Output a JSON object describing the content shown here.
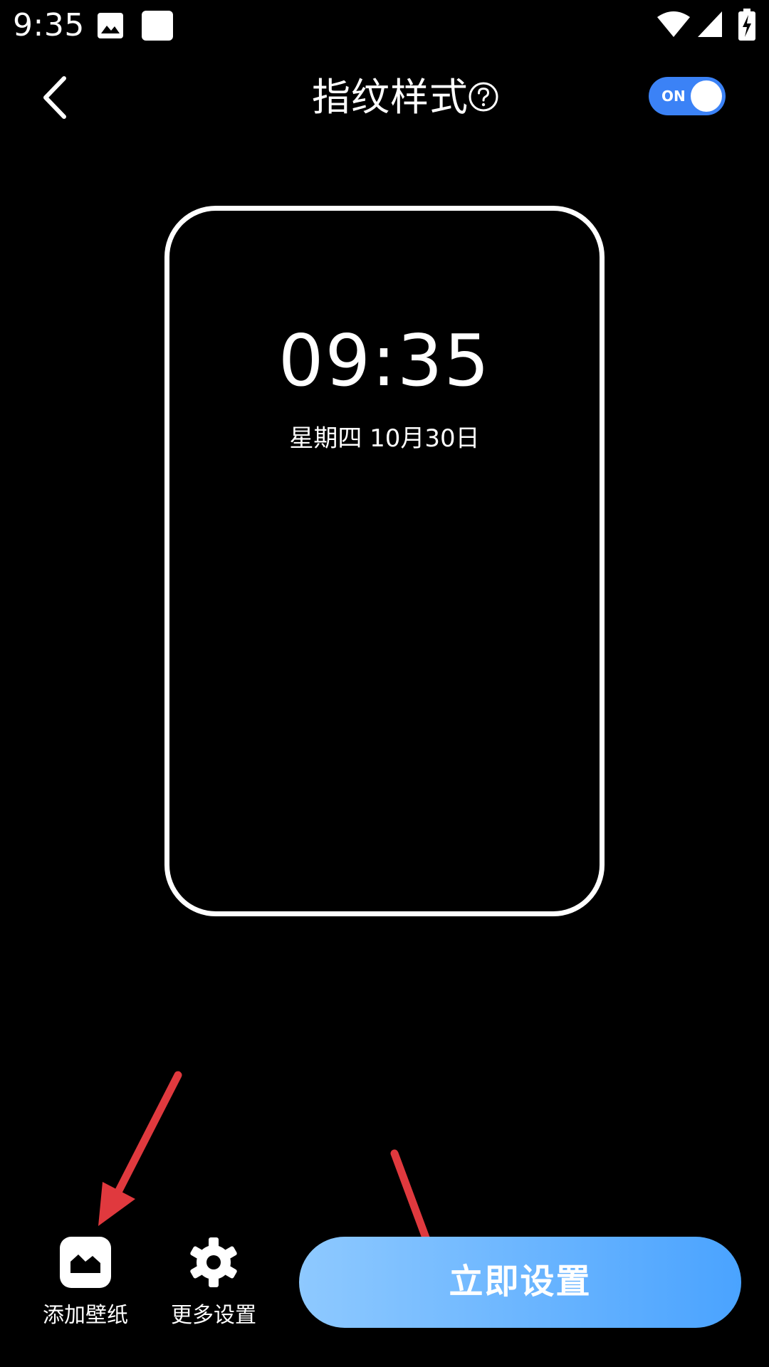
{
  "status_bar": {
    "time": "9:35",
    "icons": [
      "gallery-icon",
      "square-app-icon",
      "wifi-icon",
      "signal-icon",
      "battery-charging-icon"
    ]
  },
  "app_bar": {
    "title": "指纹样式",
    "toggle_label": "ON",
    "toggle_on": true,
    "toggle_color": "#3b82f6"
  },
  "preview": {
    "time": "09:35",
    "date": "星期四 10月30日"
  },
  "actions": {
    "add_wallpaper": "添加壁纸",
    "more_settings": "更多设置",
    "primary": "立即设置"
  },
  "colors": {
    "background": "#000000",
    "primary_gradient_start": "#8ec9ff",
    "primary_gradient_end": "#4aa3ff",
    "annotation_arrow": "#e0393e"
  }
}
